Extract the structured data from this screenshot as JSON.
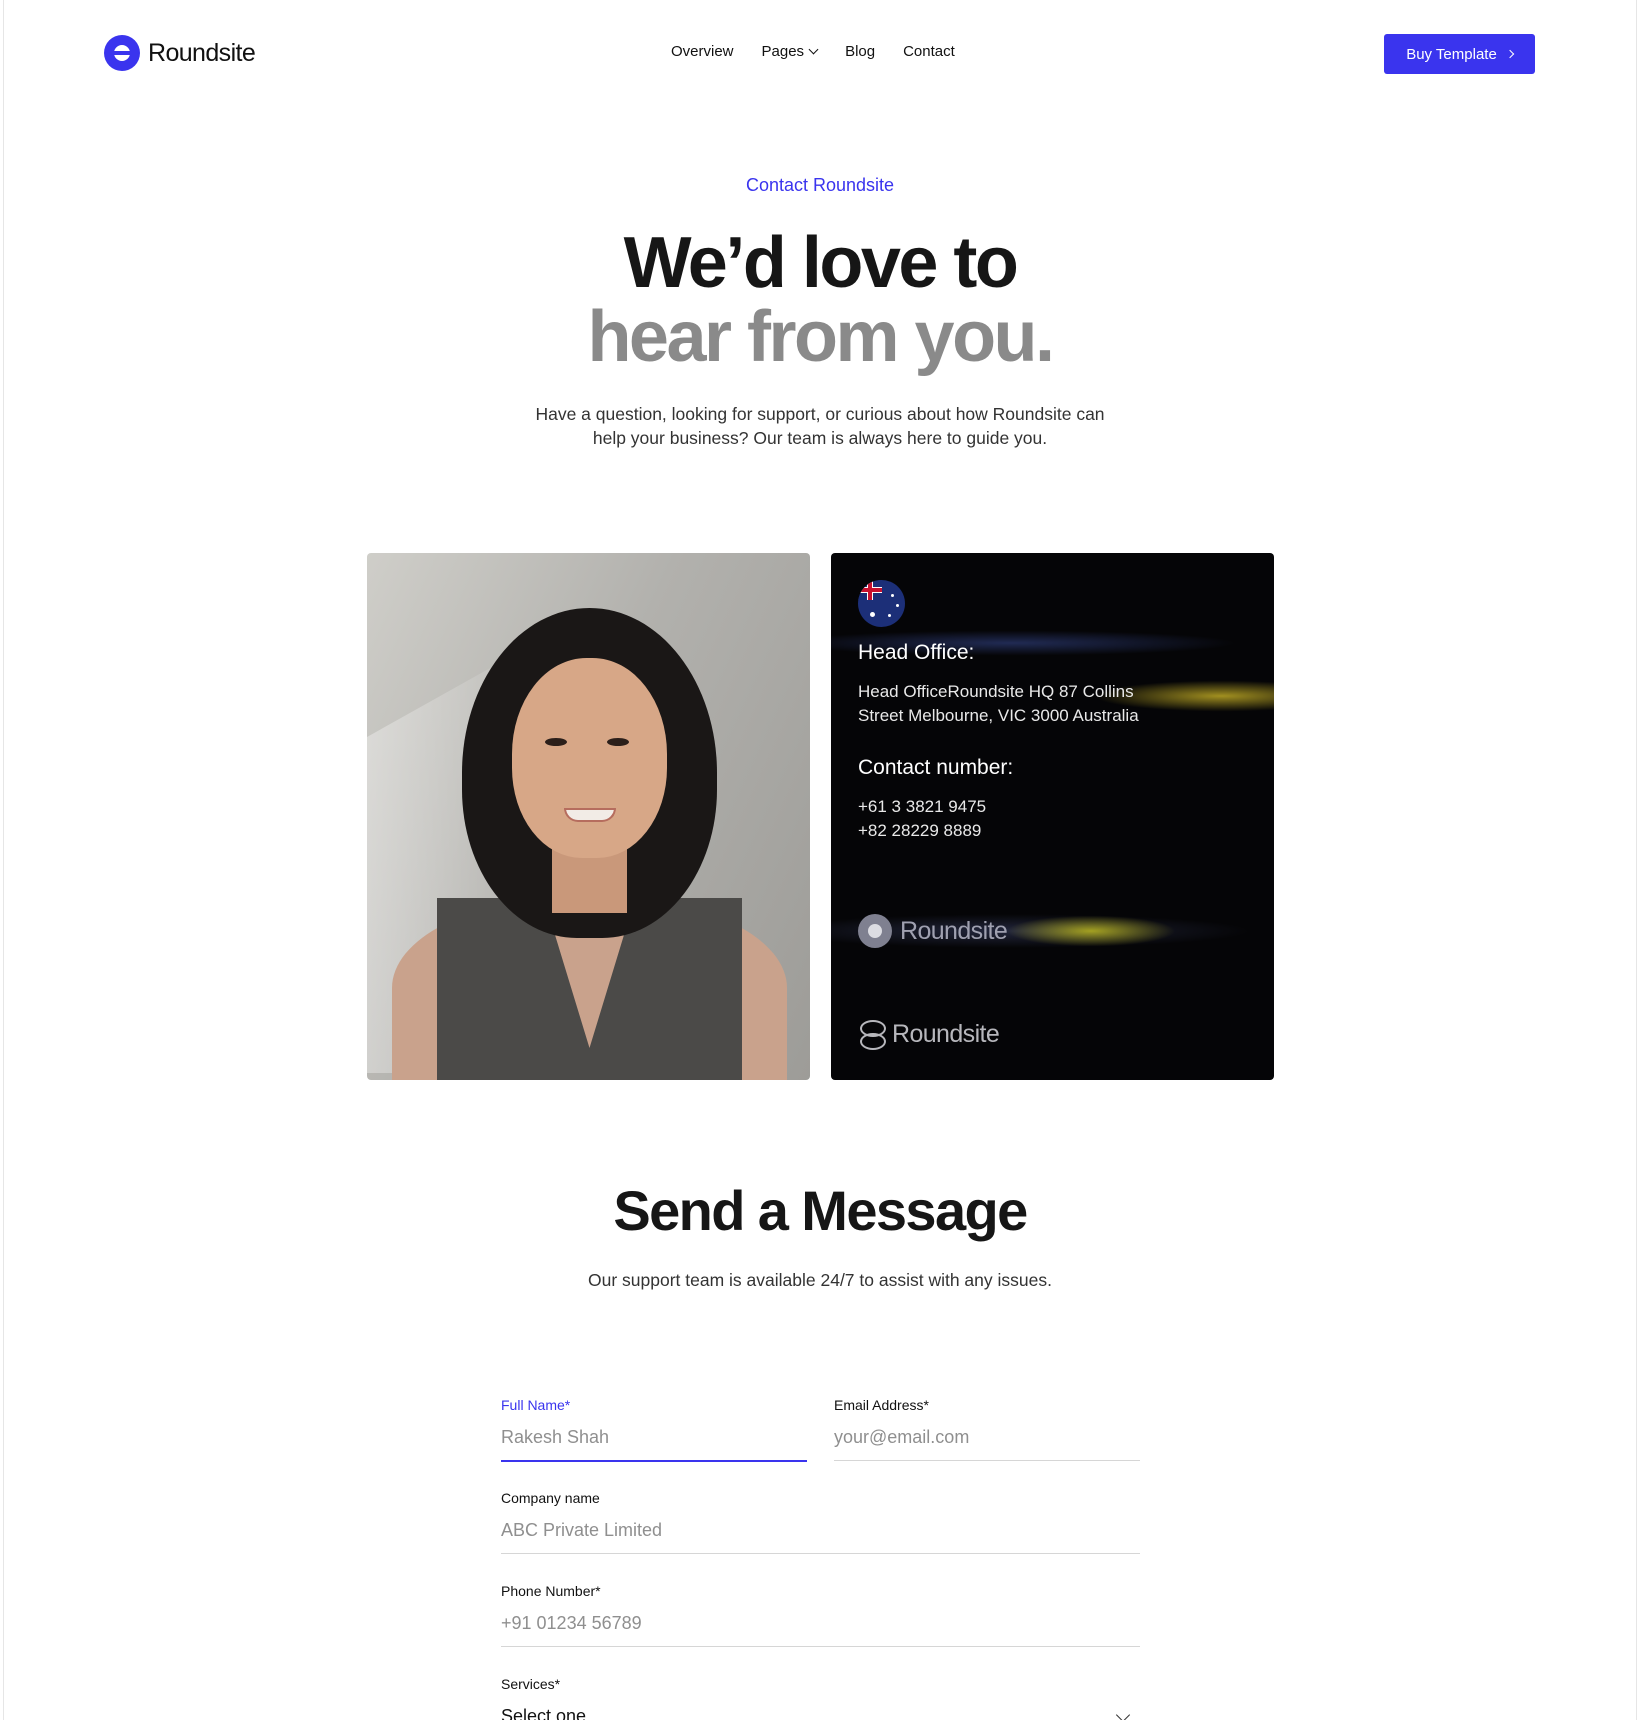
{
  "brand": {
    "name": "Roundsite",
    "accent": "#3a34ee"
  },
  "nav": {
    "items": [
      {
        "label": "Overview"
      },
      {
        "label": "Pages",
        "has_dropdown": true
      },
      {
        "label": "Blog"
      },
      {
        "label": "Contact"
      }
    ],
    "cta": "Buy Template"
  },
  "hero": {
    "eyebrow": "Contact Roundsite",
    "title_line1": "We’d love to",
    "title_line2": "hear from you.",
    "subtitle": "Have a question, looking for support, or curious about how Roundsite can help your business? Our team is always here to guide you."
  },
  "office": {
    "head_office_title": "Head Office:",
    "head_office_address_line1": "Head OfficeRoundsite HQ 87 Collins",
    "head_office_address_line2": "Street Melbourne, VIC 3000 Australia",
    "contact_title": "Contact number:",
    "phone1": "+61 3 3821 9475",
    "phone2": "+82 28229 8889",
    "brand_ghost_1": "Roundsite",
    "brand_ghost_2": "Roundsite",
    "flag_icon": "australia-flag-icon"
  },
  "form": {
    "title": "Send a Message",
    "subtitle": "Our support team is available 24/7 to assist with any issues.",
    "full_name": {
      "label": "Full Name*",
      "placeholder": "Rakesh Shah"
    },
    "email": {
      "label": "Email Address*",
      "placeholder": "your@email.com"
    },
    "company": {
      "label": "Company name",
      "placeholder": "ABC Private Limited"
    },
    "phone": {
      "label": "Phone Number*",
      "placeholder": "+91 01234 56789"
    },
    "services": {
      "label": "Services*",
      "selected": "Select one"
    }
  }
}
